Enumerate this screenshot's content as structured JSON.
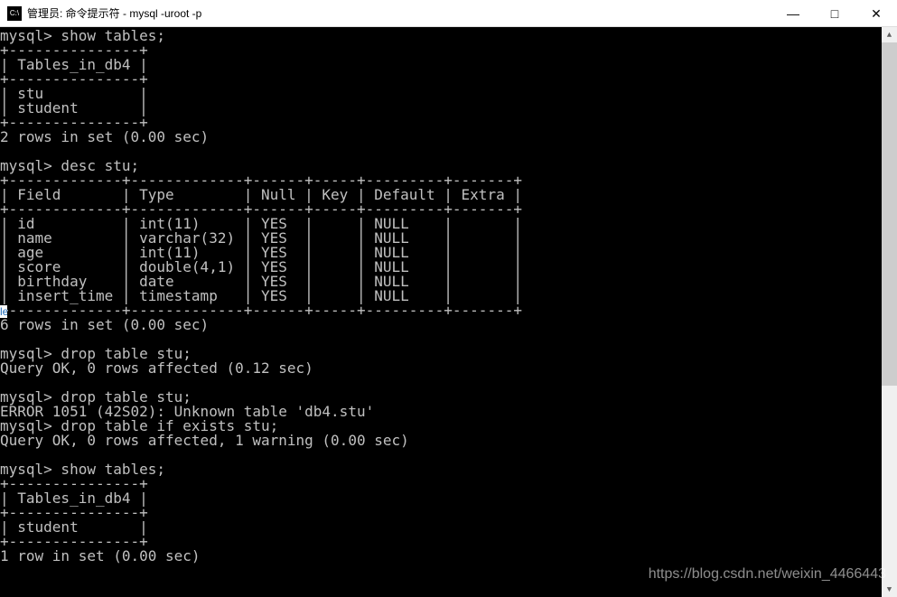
{
  "window": {
    "title": "管理员: 命令提示符 - mysql  -uroot -p",
    "icon_label": "C:\\"
  },
  "controls": {
    "minimize": "—",
    "maximize": "□",
    "close": "✕"
  },
  "terminal": {
    "prompt": "mysql>",
    "cmd1": "show tables;",
    "tables_header": "Tables_in_db4",
    "tables_row1": "stu",
    "tables_row2": "student",
    "result_2rows": "2 rows in set (0.00 sec)",
    "cmd2": "desc stu;",
    "desc_headers": {
      "field": "Field",
      "type": "Type",
      "null": "Null",
      "key": "Key",
      "default": "Default",
      "extra": "Extra"
    },
    "desc_rows": [
      {
        "field": "id",
        "type": "int(11)",
        "null": "YES",
        "key": "",
        "default": "NULL",
        "extra": ""
      },
      {
        "field": "name",
        "type": "varchar(32)",
        "null": "YES",
        "key": "",
        "default": "NULL",
        "extra": ""
      },
      {
        "field": "age",
        "type": "int(11)",
        "null": "YES",
        "key": "",
        "default": "NULL",
        "extra": ""
      },
      {
        "field": "score",
        "type": "double(4,1)",
        "null": "YES",
        "key": "",
        "default": "NULL",
        "extra": ""
      },
      {
        "field": "birthday",
        "type": "date",
        "null": "YES",
        "key": "",
        "default": "NULL",
        "extra": ""
      },
      {
        "field": "insert_time",
        "type": "timestamp",
        "null": "YES",
        "key": "",
        "default": "NULL",
        "extra": ""
      }
    ],
    "result_6rows": "6 rows in set (0.00 sec)",
    "cmd3": "drop table stu;",
    "result_query_ok_012": "Query OK, 0 rows affected (0.12 sec)",
    "cmd4": "drop table stu;",
    "error_1051": "ERROR 1051 (42S02): Unknown table 'db4.stu'",
    "cmd5": "drop table if exists stu;",
    "result_query_ok_warn": "Query OK, 0 rows affected, 1 warning (0.00 sec)",
    "cmd6": "show tables;",
    "tables2_header": "Tables_in_db4",
    "tables2_row1": "student",
    "result_1row": "1 row in set (0.00 sec)"
  },
  "watermark": "https://blog.csdn.net/weixin_4466443",
  "left_fragment": "le"
}
